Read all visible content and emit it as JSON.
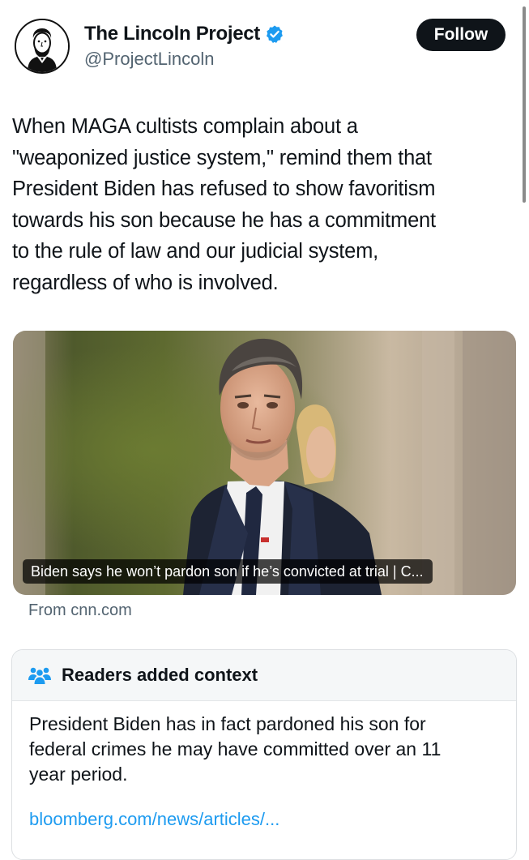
{
  "author": {
    "display_name": "The Lincoln Project",
    "handle": "@ProjectLincoln",
    "verified": true,
    "avatar_icon": "lincoln-portrait-icon"
  },
  "follow_button": {
    "label": "Follow"
  },
  "tweet": {
    "lines": [
      "When MAGA cultists complain about a",
      "\"weaponized justice system,\" remind them that",
      "President Biden has refused to show favoritism",
      "towards his son because he has a commitment",
      "to the rule of law and our judicial system,",
      "regardless of who is involved."
    ]
  },
  "link_card": {
    "caption": "Biden says he won’t pardon son if he’s convicted at trial | C...",
    "source": "From cnn.com"
  },
  "community_note": {
    "icon": "people-icon",
    "title": "Readers added context",
    "lines": [
      "President Biden has in fact pardoned his son for",
      "federal crimes he may have committed over an 11",
      "year period."
    ],
    "link": "bloomberg.com/news/articles/..."
  },
  "colors": {
    "text": "#0f1419",
    "secondary": "#536471",
    "link": "#1d9bf0",
    "verified": "#1d9bf0",
    "button_bg": "#0f1419",
    "note_header_bg": "#f5f7f8",
    "note_icon": "#1d9bf0"
  }
}
